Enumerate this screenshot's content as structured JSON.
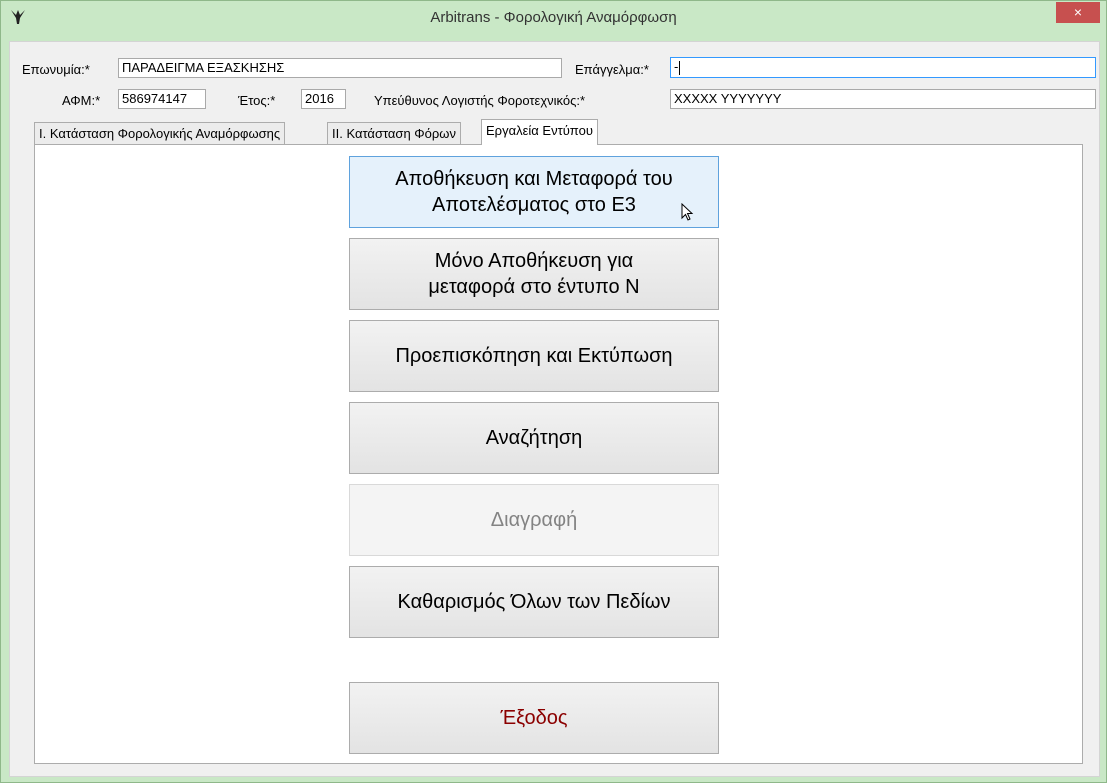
{
  "window": {
    "title": "Arbitrans - Φορολογική Αναμόρφωση",
    "close_label": "×"
  },
  "form": {
    "name_label": "Επωνυμία:*",
    "name_value": "ΠΑΡΑΔΕΙΓΜΑ ΕΞΑΣΚΗΣΗΣ",
    "profession_label": "Επάγγελμα:*",
    "profession_value": "-",
    "afm_label": "ΑΦΜ:*",
    "afm_value": "586974147",
    "year_label": "Έτος:*",
    "year_value": "2016",
    "accountant_label": "Υπεύθυνος Λογιστής Φοροτεχνικός:*",
    "accountant_value": "XXXXX YYYYYYY"
  },
  "tabs": [
    {
      "label": "I. Κατάσταση Φορολογικής Αναμόρφωσης",
      "active": false
    },
    {
      "label": "II. Κατάσταση Φόρων",
      "active": false
    },
    {
      "label": "Εργαλεία Εντύπου",
      "active": true
    }
  ],
  "buttons": {
    "save_transfer_line1": "Αποθήκευση και Μεταφορά του",
    "save_transfer_line2": "Αποτελέσματος στο Ε3",
    "save_only_line1": "Μόνο Αποθήκευση για",
    "save_only_line2": "μεταφορά στο έντυπο Ν",
    "preview_print": "Προεπισκόπηση και Εκτύπωση",
    "search": "Αναζήτηση",
    "delete": "Διαγραφή",
    "clear_all": "Καθαρισμός Όλων των Πεδίων",
    "exit": "Έξοδος"
  },
  "colors": {
    "window_frame": "#c9e8c6",
    "close_button": "#c7504f",
    "exit_text": "#8b0000",
    "hover_button": "#e5f1fb",
    "focus_border": "#3399ff"
  }
}
